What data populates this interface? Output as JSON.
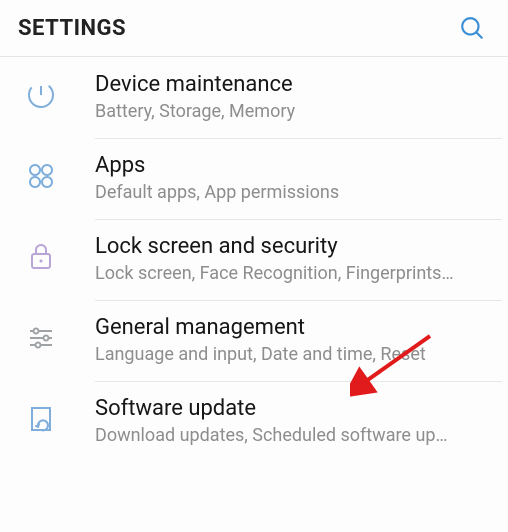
{
  "header": {
    "title": "SETTINGS"
  },
  "items": [
    {
      "title": "Device maintenance",
      "subtitle": "Battery, Storage, Memory"
    },
    {
      "title": "Apps",
      "subtitle": "Default apps, App permissions"
    },
    {
      "title": "Lock screen and security",
      "subtitle": "Lock screen, Face Recognition, Fingerprints…"
    },
    {
      "title": "General management",
      "subtitle": "Language and input, Date and time, Reset"
    },
    {
      "title": "Software update",
      "subtitle": "Download updates, Scheduled software up…"
    }
  ],
  "annotation": {
    "arrow_color": "#e11b1b"
  }
}
